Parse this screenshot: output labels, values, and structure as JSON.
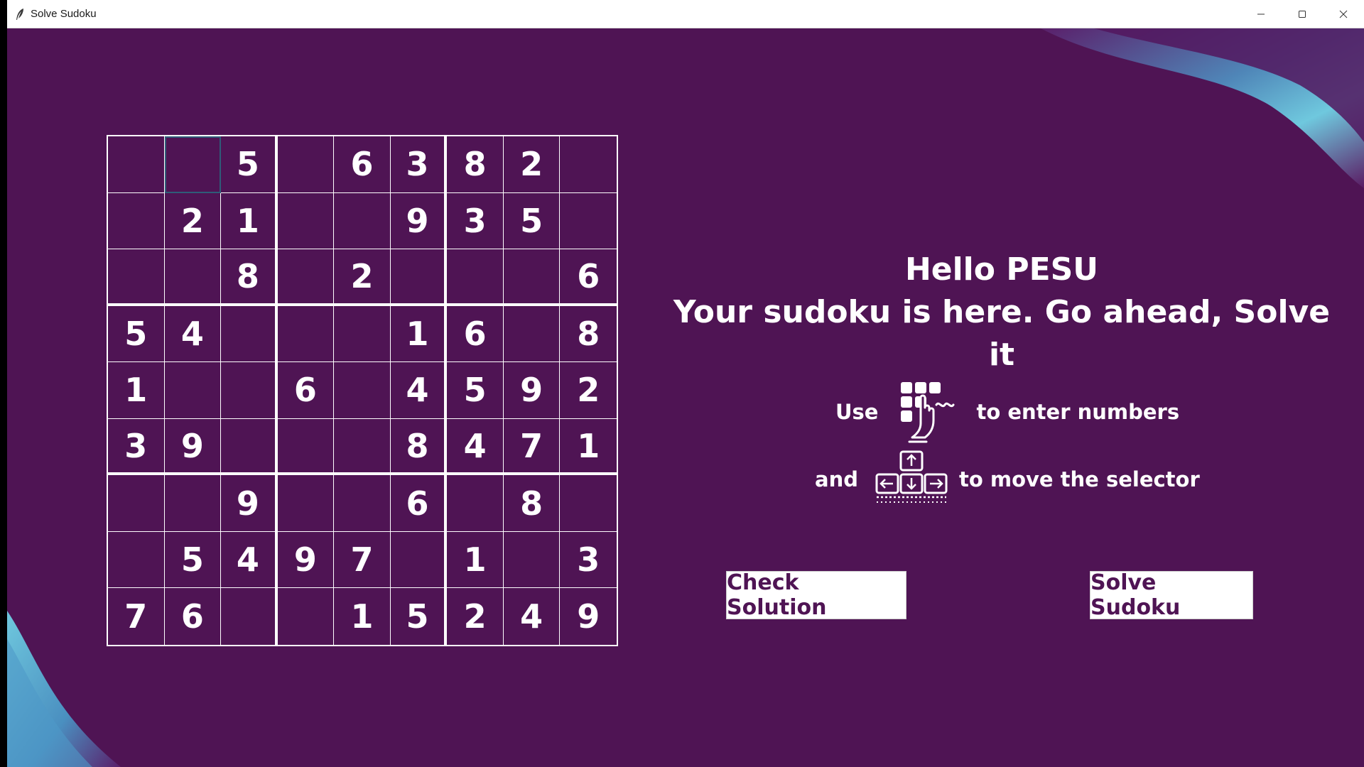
{
  "window": {
    "title": "Solve Sudoku",
    "icon": "feather-icon",
    "controls": [
      "minimize-icon",
      "maximize-icon",
      "close-icon"
    ]
  },
  "colors": {
    "background": "#4f1454",
    "accent_blob": "#5fb8d6",
    "grid_lines": "#ffffff",
    "selected_cell": "#2f5c79",
    "button_bg": "#ffffff",
    "button_text": "#4f1454"
  },
  "board": {
    "selected": {
      "row": 0,
      "col": 1
    },
    "rows": [
      [
        "",
        "",
        "5",
        "",
        "6",
        "3",
        "8",
        "2",
        ""
      ],
      [
        "",
        "2",
        "1",
        "",
        "",
        "9",
        "3",
        "5",
        ""
      ],
      [
        "",
        "",
        "8",
        "",
        "2",
        "",
        "",
        "",
        "6"
      ],
      [
        "5",
        "4",
        "",
        "",
        "",
        "1",
        "6",
        "",
        "8"
      ],
      [
        "1",
        "",
        "",
        "6",
        "",
        "4",
        "5",
        "9",
        "2"
      ],
      [
        "3",
        "9",
        "",
        "",
        "",
        "8",
        "4",
        "7",
        "1"
      ],
      [
        "",
        "",
        "9",
        "",
        "",
        "6",
        "",
        "8",
        ""
      ],
      [
        "",
        "5",
        "4",
        "9",
        "7",
        "",
        "1",
        "",
        "3"
      ],
      [
        "7",
        "6",
        "",
        "",
        "1",
        "5",
        "2",
        "4",
        "9"
      ]
    ]
  },
  "heading": {
    "greeting": "Hello PESU",
    "subtitle": "Your sudoku is here. Go ahead, Solve it"
  },
  "instructions": {
    "line1_prefix": "Use",
    "line1_icon": "numpad-touch-icon",
    "line1_suffix": "to enter numbers",
    "line2_prefix": "and",
    "line2_icon": "arrow-keys-icon",
    "line2_suffix": "to move the selector"
  },
  "buttons": {
    "check_label": "Check Solution",
    "solve_label": "Solve Sudoku"
  }
}
